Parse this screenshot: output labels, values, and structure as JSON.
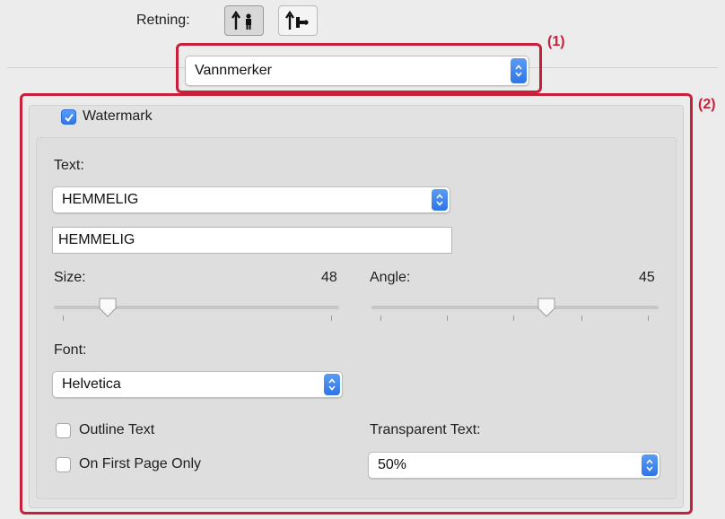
{
  "orientation": {
    "label": "Retning:",
    "options": [
      {
        "name": "portrait",
        "selected": true
      },
      {
        "name": "landscape",
        "selected": false
      }
    ]
  },
  "callouts": {
    "one": "(1)",
    "two": "(2)"
  },
  "panel_select": {
    "value": "Vannmerker"
  },
  "watermark": {
    "enabled": true,
    "checkbox_label": "Watermark",
    "text_label": "Text:",
    "text_select_value": "HEMMELIG",
    "text_field_value": "HEMMELIG",
    "size": {
      "label": "Size:",
      "value": "48",
      "slider_fraction": 0.19
    },
    "angle": {
      "label": "Angle:",
      "value": "45",
      "slider_fraction": 0.61
    },
    "font_label": "Font:",
    "font_value": "Helvetica",
    "outline_text": {
      "label": "Outline Text",
      "checked": false
    },
    "first_page_only": {
      "label": "On First Page Only",
      "checked": false
    },
    "transparent_text_label": "Transparent Text:",
    "transparent_text_value": "50%"
  },
  "colors": {
    "accent": "#2f76e8",
    "callout": "#c8203a"
  }
}
